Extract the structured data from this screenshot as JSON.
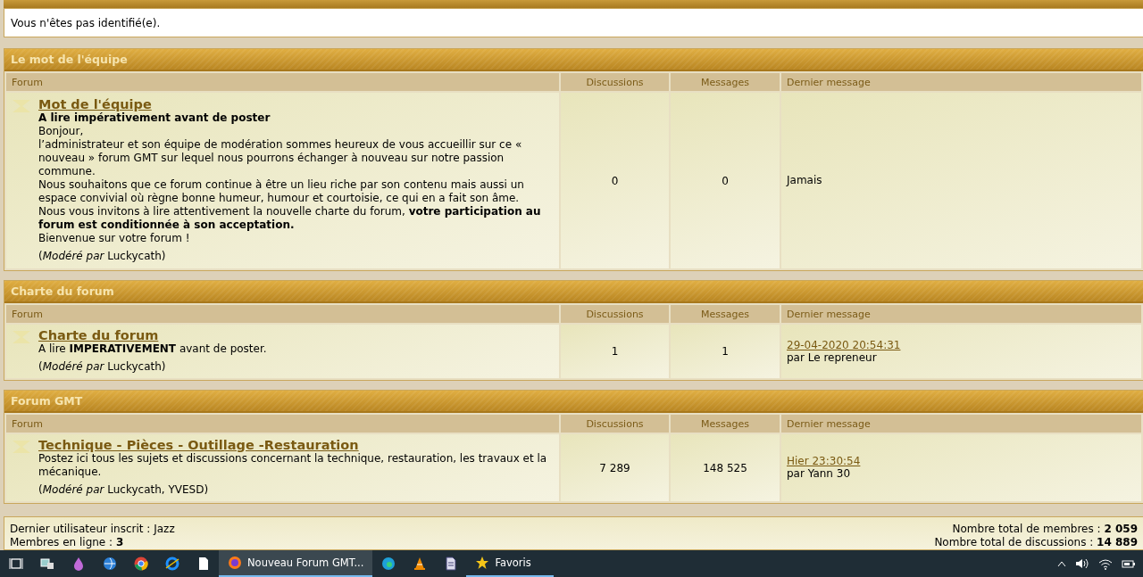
{
  "notice": "Vous n'êtes pas identifié(e).",
  "categories": [
    {
      "title": "Le mot de l'équipe",
      "columns": [
        "Forum",
        "Discussions",
        "Messages",
        "Dernier message"
      ],
      "forums": [
        {
          "name": "Mot de l'équipe",
          "description": [
            "**A lire impérativement avant de poster**",
            "Bonjour,",
            "l’administrateur et son équipe de modération sommes heureux de vous accueillir sur ce « nouveau » forum GMT sur lequel nous pourrons échanger à nouveau sur notre passion commune.",
            "Nous souhaitons que ce forum continue à être un lieu riche par son contenu mais aussi un espace convivial où règne bonne humeur, humour et courtoisie, ce qui en a fait son âme.",
            "Nous vous invitons à lire attentivement la nouvelle charte du forum, **votre participation au forum est conditionnée à son acceptation.**",
            "Bienvenue sur votre forum !"
          ],
          "moderators": "(*Modéré par* Luckycath)",
          "discussions": "0",
          "messages": "0",
          "last_post": {
            "text": "Jamais"
          }
        }
      ]
    },
    {
      "title": "Charte du forum",
      "columns": [
        "Forum",
        "Discussions",
        "Messages",
        "Dernier message"
      ],
      "forums": [
        {
          "name": "Charte du forum",
          "description": [
            "A lire **IMPERATIVEMENT** avant de poster."
          ],
          "moderators": "(*Modéré par* Luckycath)",
          "discussions": "1",
          "messages": "1",
          "last_post": {
            "date": "29-04-2020 20:54:31",
            "author": "par Le repreneur"
          }
        }
      ]
    },
    {
      "title": "Forum GMT",
      "columns": [
        "Forum",
        "Discussions",
        "Messages",
        "Dernier message"
      ],
      "forums": [
        {
          "name": "Technique - Pièces - Outillage -Restauration",
          "description": [
            "Postez ici tous les sujets et discussions concernant la technique, restauration, les travaux et la mécanique."
          ],
          "moderators": "(*Modéré par* Luckycath, YVESD)",
          "discussions": "7 289",
          "messages": "148 525",
          "last_post": {
            "date": "Hier 23:30:54",
            "author": "par Yann 30"
          }
        }
      ]
    }
  ],
  "stats": {
    "left": [
      "Dernier utilisateur inscrit : Jazz",
      "Membres en ligne : **3**"
    ],
    "right": [
      "Nombre total de membres : **2 059**",
      "Nombre total de discussions : **14 889**"
    ]
  },
  "taskbar": {
    "windows": [
      {
        "label": "Nouveau Forum GMT...",
        "selected": true
      },
      {
        "label": "Favoris",
        "selected": false
      }
    ]
  }
}
